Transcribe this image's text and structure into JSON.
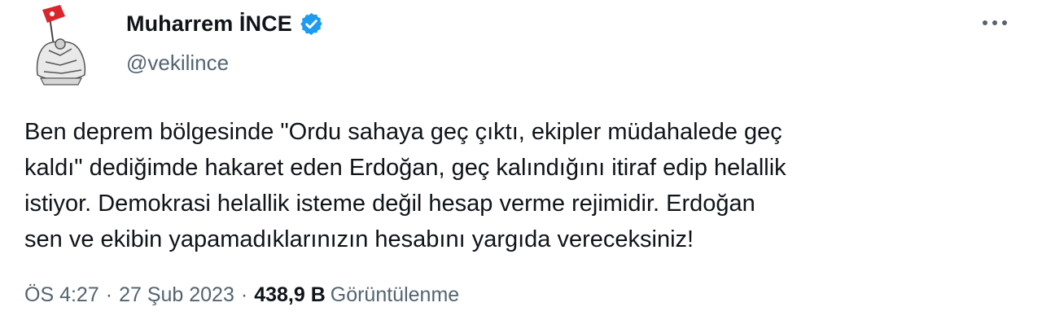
{
  "author": {
    "display_name": "Muharrem İNCE",
    "handle": "@vekilince",
    "verified_color": "#1d9bf0"
  },
  "icons": {
    "avatar": "avatar-with-flag-icon",
    "verified": "verified-badge-icon",
    "more": "more-options-icon"
  },
  "tweet": {
    "text": "Ben deprem bölgesinde \"Ordu sahaya geç çıktı, ekipler müdahalede geç\nkaldı\" dediğimde hakaret eden Erdoğan, geç kalındığını itiraf edip helallik\nistiyor. Demokrasi helallik isteme değil hesap verme rejimidir. Erdoğan\nsen ve ekibin yapamadıklarınızın hesabını yargıda vereceksiniz!",
    "time": "ÖS 4:27",
    "date": "27 Şub 2023",
    "separator": "·",
    "views_count": "438,9 B",
    "views_label": "Görüntülenme"
  }
}
